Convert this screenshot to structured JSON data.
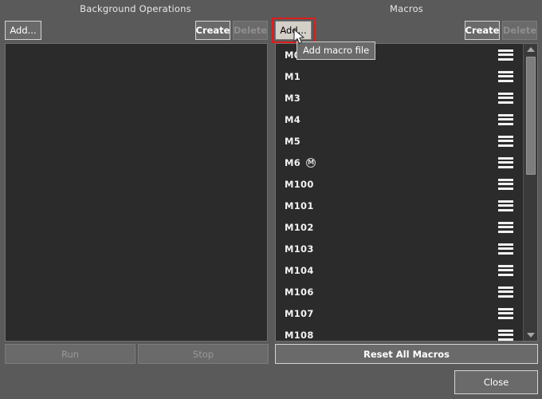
{
  "panels": {
    "left": {
      "title": "Background Operations",
      "toolbar": {
        "add": "Add...",
        "create": "Create",
        "delete": "Delete"
      },
      "items": []
    },
    "right": {
      "title": "Macros",
      "toolbar": {
        "add": "Add...",
        "create": "Create",
        "delete": "Delete"
      },
      "items": [
        {
          "label": "M0",
          "badge": "",
          "icon": "list-menu-icon"
        },
        {
          "label": "M1",
          "badge": "",
          "icon": "list-menu-icon"
        },
        {
          "label": "M3",
          "badge": "",
          "icon": "list-menu-icon"
        },
        {
          "label": "M4",
          "badge": "",
          "icon": "list-menu-icon"
        },
        {
          "label": "M5",
          "badge": "",
          "icon": "list-menu-icon"
        },
        {
          "label": "M6",
          "badge": "M",
          "icon": "list-menu-icon"
        },
        {
          "label": "M100",
          "badge": "",
          "icon": "list-menu-icon"
        },
        {
          "label": "M101",
          "badge": "",
          "icon": "list-menu-icon"
        },
        {
          "label": "M102",
          "badge": "",
          "icon": "list-menu-icon"
        },
        {
          "label": "M103",
          "badge": "",
          "icon": "list-menu-icon"
        },
        {
          "label": "M104",
          "badge": "",
          "icon": "list-menu-icon"
        },
        {
          "label": "M106",
          "badge": "",
          "icon": "list-menu-icon"
        },
        {
          "label": "M107",
          "badge": "",
          "icon": "list-menu-icon"
        },
        {
          "label": "M108",
          "badge": "",
          "icon": "list-menu-icon"
        }
      ]
    }
  },
  "tooltip": {
    "text": "Add macro file"
  },
  "actions": {
    "run": "Run",
    "stop": "Stop",
    "reset_all_macros": "Reset All Macros",
    "close": "Close"
  },
  "scrollbar": {
    "up_icon": "chevron-up-icon",
    "down_icon": "chevron-down-icon"
  },
  "colors": {
    "window_bg": "#5a5a5a",
    "pane_bg": "#2b2b2b",
    "button_bg": "#6a6a6a",
    "button_border": "#d5d5d5",
    "disabled_text": "#8e8e8e",
    "focus_ring": "#e01b1b",
    "text": "#ffffff"
  }
}
